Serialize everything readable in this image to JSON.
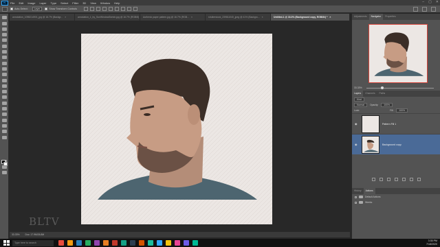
{
  "app": {
    "logo": "Ps"
  },
  "menu": [
    "File",
    "Edit",
    "Image",
    "Layer",
    "Type",
    "Select",
    "Filter",
    "3D",
    "View",
    "Window",
    "Help"
  ],
  "options": {
    "auto_select_label": "Auto-Select:",
    "auto_select_value": "Layer",
    "show_transform_label": "Show Transform Controls"
  },
  "tabs": [
    {
      "label": "annotation_1098214901_jpg @ 16.7% (Backgr...",
      "active": false
    },
    {
      "label": "annotation_1_by_SunWindowSketch.jpg @ 16.7% (RGB/8)",
      "active": false
    },
    {
      "label": "Authenic paper pattern.jpg @ 16.7% (RGB...",
      "active": false
    },
    {
      "label": "shutterstock_239811040_jpeg @ 41% (Backgro...",
      "active": false
    },
    {
      "label": "Untitled-1 @ 33.3% (Background copy, RGB/8#) *",
      "active": true
    }
  ],
  "status": {
    "zoom": "33.33%",
    "doc": "Doc: 17.9M/26.8M"
  },
  "watermark": "BLTV",
  "panel_tabs_top": [
    "Adjustments",
    "Navigator",
    "Properties"
  ],
  "navigator": {
    "zoom": "33.33%"
  },
  "panel_tabs_layers": [
    "Layers",
    "Channels",
    "Paths"
  ],
  "layers_controls": {
    "kind": "Kind",
    "blend": "Normal",
    "opacity_label": "Opacity:",
    "opacity": "100%",
    "lock_label": "Lock:",
    "fill_label": "Fill:",
    "fill": "100%"
  },
  "layers": [
    {
      "name": "Pattern Fill 1",
      "active": false
    },
    {
      "name": "Background copy",
      "active": true
    }
  ],
  "panel_tabs_actions": [
    "History",
    "Actions"
  ],
  "actions": [
    "Default Actions",
    "Weeks"
  ],
  "taskbar": {
    "search": "Type here to search",
    "time": "3:35 PM",
    "date": "7/18/2020"
  },
  "taskbar_app_colors": [
    "#e74c3c",
    "#f39c12",
    "#2980b9",
    "#27ae60",
    "#8e44ad",
    "#e67e22",
    "#c0392b",
    "#16a085",
    "#2c3e50",
    "#d35400",
    "#1abc9c",
    "#31a8ff",
    "#f1c40f",
    "#e84393",
    "#6c5ce7",
    "#00b894"
  ]
}
